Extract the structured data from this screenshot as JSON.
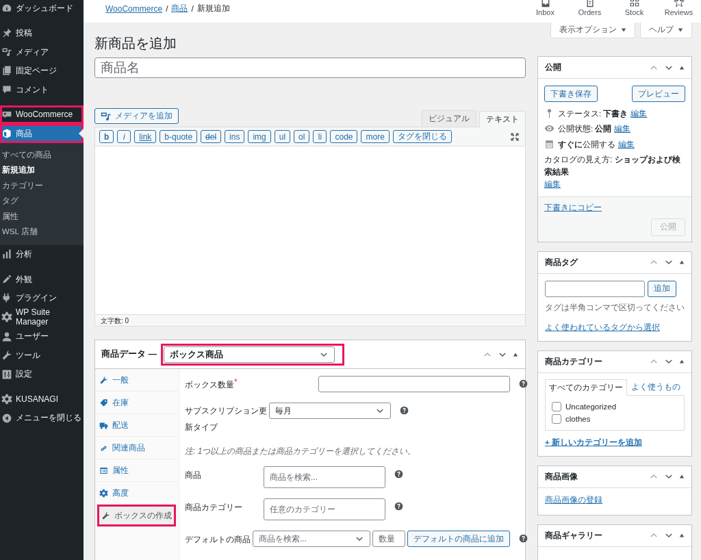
{
  "sidebar": {
    "groups": [
      [
        {
          "label": "ダッシュボード",
          "selected": false,
          "highlighted": false
        }
      ],
      [
        {
          "label": "投稿",
          "selected": false,
          "highlighted": false
        },
        {
          "label": "メディア",
          "selected": false,
          "highlighted": false
        },
        {
          "label": "固定ページ",
          "selected": false,
          "highlighted": false
        },
        {
          "label": "コメント",
          "selected": false,
          "highlighted": false
        }
      ],
      [
        {
          "label": "WooCommerce",
          "selected": false,
          "highlighted": true
        },
        {
          "label": "商品",
          "selected": true,
          "highlighted": true,
          "children": [
            {
              "label": "すべての商品",
              "selected": false
            },
            {
              "label": "新規追加",
              "selected": true
            },
            {
              "label": "カテゴリー",
              "selected": false
            },
            {
              "label": "タグ",
              "selected": false
            },
            {
              "label": "属性",
              "selected": false
            },
            {
              "label": "WSL 店舗",
              "selected": false
            }
          ]
        },
        {
          "label": "分析",
          "selected": false,
          "highlighted": false
        }
      ],
      [
        {
          "label": "外観",
          "selected": false,
          "highlighted": false
        },
        {
          "label": "プラグイン",
          "selected": false,
          "highlighted": false
        },
        {
          "label": "WP Suite Manager",
          "selected": false,
          "highlighted": false
        },
        {
          "label": "ユーザー",
          "selected": false,
          "highlighted": false
        },
        {
          "label": "ツール",
          "selected": false,
          "highlighted": false
        },
        {
          "label": "設定",
          "selected": false,
          "highlighted": false
        }
      ],
      [
        {
          "label": "KUSANAGI",
          "selected": false,
          "highlighted": false
        },
        {
          "label": "メニューを閉じる",
          "selected": false,
          "highlighted": false
        }
      ]
    ]
  },
  "breadcrumbs": [
    {
      "label": "WooCommerce",
      "link": true,
      "separator": "/"
    },
    {
      "label": "商品",
      "link": true,
      "separator": "/"
    },
    {
      "label": "新規追加",
      "link": false
    }
  ],
  "activity_bar": [
    {
      "label": "Inbox"
    },
    {
      "label": "Orders"
    },
    {
      "label": "Stock"
    },
    {
      "label": "Reviews"
    }
  ],
  "screen_meta": [
    "表示オプション",
    "ヘルプ"
  ],
  "page_title": "新商品を追加",
  "title_field": {
    "placeholder": "商品名"
  },
  "editor": {
    "add_media": "メディアを追加",
    "tabs": [
      {
        "label": "ビジュアル",
        "selected": false
      },
      {
        "label": "テキスト",
        "selected": true
      }
    ],
    "quicktags": [
      "b",
      "i",
      "link",
      "b-quote",
      "del",
      "ins",
      "img",
      "ul",
      "ol",
      "li",
      "code",
      "more",
      "タグを閉じる"
    ],
    "word_count": "文字数: 0"
  },
  "product_data": {
    "title": "商品データ —",
    "type_select": {
      "value": "ボックス商品",
      "highlighted": true
    },
    "tabs": [
      {
        "label": "一般",
        "selected": false,
        "highlighted": false
      },
      {
        "label": "在庫",
        "selected": false,
        "highlighted": false
      },
      {
        "label": "配送",
        "selected": false,
        "highlighted": false
      },
      {
        "label": "関連商品",
        "selected": false,
        "highlighted": false
      },
      {
        "label": "属性",
        "selected": false,
        "highlighted": false
      },
      {
        "label": "高度",
        "selected": false,
        "highlighted": false
      },
      {
        "label": "ボックスの作成",
        "selected": true,
        "highlighted": true
      }
    ],
    "fields": [
      {
        "kind": "input",
        "label": "ボックス数量",
        "required_mark": "*"
      },
      {
        "kind": "select",
        "label": "サブスクリプション更新タイプ",
        "value": "毎月"
      },
      {
        "kind": "note",
        "text": "注: 1つ以上の商品または商品カテゴリーを選択してください。"
      },
      {
        "kind": "search",
        "label": "商品",
        "placeholder": "商品を検索..."
      },
      {
        "kind": "search",
        "label": "商品カテゴリー",
        "placeholder": "任意のカテゴリー"
      },
      {
        "kind": "default",
        "label": "デフォルトの商品",
        "placeholder": "商品を検索...",
        "qty_placeholder": "数量",
        "button": "デフォルトの商品に追加"
      }
    ]
  },
  "publish": {
    "title": "公開",
    "save_draft": "下書き保存",
    "preview": "プレビュー",
    "rows": [
      {
        "text": "ステータス: **下書き**",
        "link": "編集"
      },
      {
        "text": "公開状態: **公開**",
        "link": "編集"
      },
      {
        "text": "**すぐに**公開する",
        "link": "編集"
      },
      {
        "text": "カタログの見え方: **ショップおよび検索結果**",
        "link": "編集"
      }
    ],
    "copy_link": "下書きにコピー",
    "publish_button": {
      "label": "公開",
      "disabled": true
    }
  },
  "tags_box": {
    "title": "商品タグ",
    "add": "追加",
    "hint": "タグは半角コンマで区切ってください",
    "link": "よく使われているタグから選択"
  },
  "categories_box": {
    "title": "商品カテゴリー",
    "tabs": [
      {
        "label": "すべてのカテゴリー",
        "selected": true
      },
      {
        "label": "よく使うもの",
        "selected": false
      }
    ],
    "items": [
      {
        "label": "Uncategorized",
        "checked": false
      },
      {
        "label": "clothes",
        "checked": false
      }
    ],
    "add_link": "+ 新しいカテゴリーを追加"
  },
  "image_box": {
    "title": "商品画像",
    "link": "商品画像の登録"
  },
  "gallery_box": {
    "title": "商品ギャラリー"
  }
}
